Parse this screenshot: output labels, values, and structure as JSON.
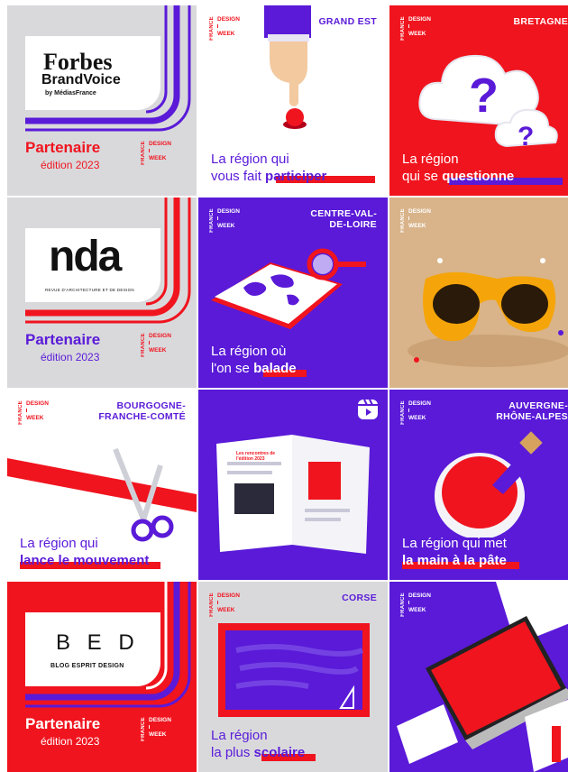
{
  "brand": {
    "line1": "DESIGN",
    "line2": "WEEK",
    "vertical": "FRANCE"
  },
  "colors": {
    "red": "#f0141e",
    "purple": "#5a1ad8",
    "grey": "#d9d9dc",
    "white": "#ffffff"
  },
  "tiles": [
    {
      "type": "partner",
      "logo_line1": "Forbes",
      "logo_line2": "BrandVoice",
      "logo_line3": "by MédiasFrance",
      "title": "Partenaire",
      "edition": "édition 2023"
    },
    {
      "type": "region",
      "region": "GRAND EST",
      "line1": "La région qui",
      "line2_prefix": "vous fait ",
      "line2_bold": "participer"
    },
    {
      "type": "region",
      "region": "BRETAGNE",
      "line1": "La région",
      "line2_prefix": "qui se ",
      "line2_bold": "questionne"
    },
    {
      "type": "partner",
      "logo_main": "nda",
      "logo_sub": "REVUE D'ARCHITECTURE ET DE DESIGN",
      "title": "Partenaire",
      "edition": "édition 2023"
    },
    {
      "type": "region",
      "region_line1": "CENTRE-VAL-",
      "region_line2": "DE-LOIRE",
      "line1": "La région où",
      "line2_prefix": "l'on se ",
      "line2_bold": "balade"
    },
    {
      "type": "photo",
      "icon": "sunglasses-photo"
    },
    {
      "type": "region",
      "region_line1": "BOURGOGNE-",
      "region_line2": "FRANCHE-COMTÉ",
      "line1": "La région qui",
      "line2_prefix": "",
      "line2_bold": "lance le mouvement"
    },
    {
      "type": "video",
      "icon": "reels-icon",
      "mag_title": "Les rencontres de l'édition 2023"
    },
    {
      "type": "region",
      "region_line1": "AUVERGNE-",
      "region_line2": "RHÔNE-ALPES",
      "line1": "La région qui met",
      "line2_prefix": "",
      "line2_bold": "la main à la pâte"
    },
    {
      "type": "partner",
      "logo_main": "B E D",
      "logo_sub": "BLOG ESPRIT DESIGN",
      "title": "Partenaire",
      "edition": "édition 2023"
    },
    {
      "type": "region",
      "region": "CORSE",
      "line1": "La région",
      "line2_prefix": "la plus ",
      "line2_bold": "scolaire"
    },
    {
      "type": "website",
      "icon": "website-mockup"
    }
  ]
}
